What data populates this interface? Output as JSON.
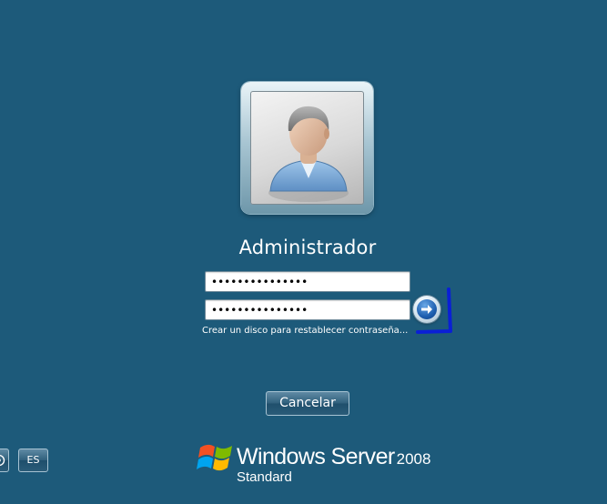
{
  "user": {
    "name": "Administrador",
    "field_1_value": "•••••••••••••••",
    "field_2_value": "•••••••••••••••"
  },
  "reset_link": "Crear un disco para restablecer contraseña...",
  "cancel_label": "Cancelar",
  "language": "ES",
  "brand": {
    "product": "Windows Server",
    "version": "2008",
    "edition": "Standard"
  },
  "icons": {
    "submit": "arrow-right-icon",
    "avatar": "user-avatar-icon",
    "ease_of_access": "ease-of-access-icon",
    "logo": "windows-flag-logo"
  },
  "colors": {
    "background": "#1d5a7a",
    "annotation": "#0a1fd6"
  }
}
